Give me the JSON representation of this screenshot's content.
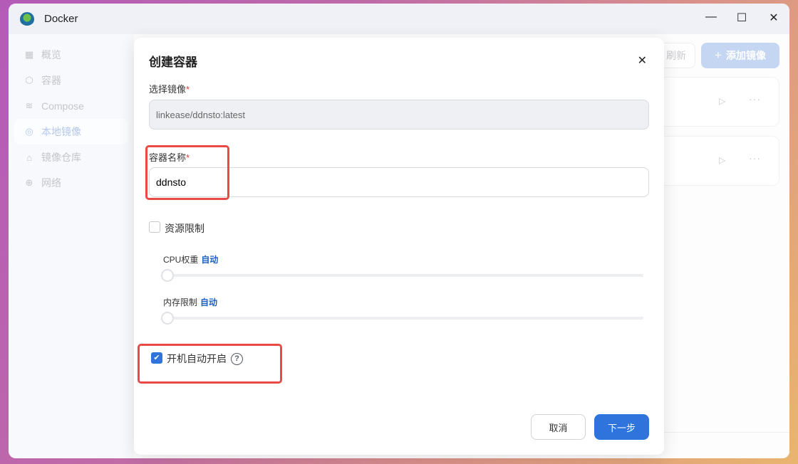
{
  "window": {
    "title": "Docker",
    "minimize": "—",
    "maximize": "☐",
    "close": "✕"
  },
  "sidebar": {
    "items": [
      {
        "label": "概览",
        "icon": "grid-icon"
      },
      {
        "label": "容器",
        "icon": "cube-icon"
      },
      {
        "label": "Compose",
        "icon": "layers-icon"
      },
      {
        "label": "本地镜像",
        "icon": "disk-icon",
        "active": true
      },
      {
        "label": "镜像仓库",
        "icon": "home-icon"
      },
      {
        "label": "网络",
        "icon": "globe-icon"
      }
    ]
  },
  "toolbar": {
    "refresh": "刷新",
    "add_image": "添加镜像",
    "add_icon": "+"
  },
  "cards": [
    {
      "play": "▷",
      "more": "···"
    },
    {
      "play": "▷",
      "more": "···"
    }
  ],
  "modal": {
    "title": "创建容器",
    "close": "✕",
    "image_label": "选择镜像",
    "required": "*",
    "image_value": "linkease/ddnsto:latest",
    "name_label": "容器名称",
    "name_value": "ddnsto",
    "resource_limit": "资源限制",
    "cpu_label": "CPU权重",
    "cpu_value": "自动",
    "cpu_fraction": 0,
    "mem_label": "内存限制",
    "mem_value": "自动",
    "mem_fraction": 0,
    "autostart": "开机自动开启",
    "autostart_checked": true,
    "help": "?",
    "cancel": "取消",
    "next": "下一步"
  },
  "colors": {
    "accent": "#2f74dc",
    "highlight": "#ea4a45"
  }
}
